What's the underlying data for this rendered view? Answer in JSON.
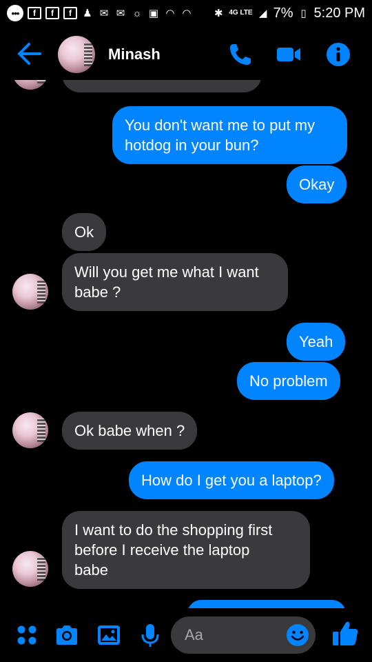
{
  "status_bar": {
    "network": "4G LTE",
    "battery": "7%",
    "time": "5:20 PM"
  },
  "header": {
    "contact_name": "Minash"
  },
  "messages": [
    {
      "from": "me",
      "text": "You don't want me to put my\nhotdog in your bun?"
    },
    {
      "from": "me",
      "text": "Okay"
    },
    {
      "from": "them",
      "text": "Ok"
    },
    {
      "from": "them",
      "text": "Will you get me what I want\nbabe ?"
    },
    {
      "from": "me",
      "text": "Yeah"
    },
    {
      "from": "me",
      "text": "No problem"
    },
    {
      "from": "them",
      "text": "Ok babe when ?"
    },
    {
      "from": "me",
      "text": "How do I get you a laptop?"
    },
    {
      "from": "them",
      "text": "I want to do the shopping first\nbefore I receive the laptop\nbabe"
    }
  ],
  "composer": {
    "placeholder": "Aa"
  },
  "colors": {
    "accent": "#0084ff",
    "incoming_bubble": "#3a3a3c",
    "background": "#000000"
  },
  "icons": {
    "header": [
      "back-arrow-icon",
      "phone-icon",
      "video-camera-icon",
      "info-icon"
    ],
    "composer": [
      "apps-grid-icon",
      "camera-icon",
      "gallery-icon",
      "microphone-icon",
      "emoji-icon",
      "thumbs-up-icon"
    ]
  }
}
